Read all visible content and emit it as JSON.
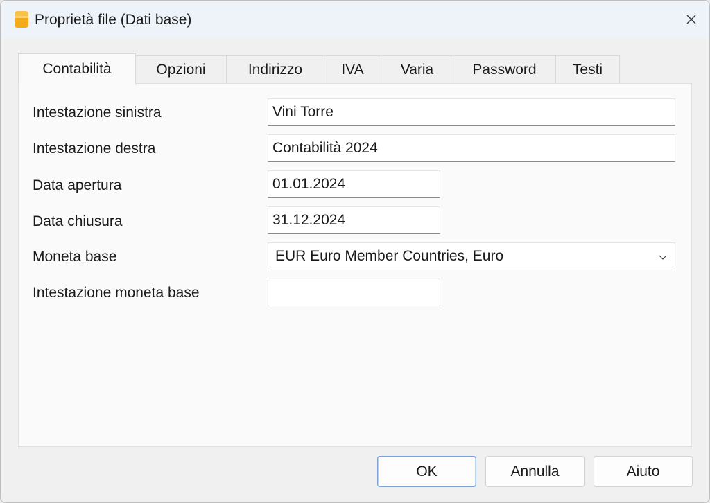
{
  "window": {
    "title": "Proprietà file (Dati base)"
  },
  "tabs": [
    {
      "label": "Contabilità",
      "active": true
    },
    {
      "label": "Opzioni"
    },
    {
      "label": "Indirizzo"
    },
    {
      "label": "IVA"
    },
    {
      "label": "Varia"
    },
    {
      "label": "Password"
    },
    {
      "label": "Testi"
    }
  ],
  "form": {
    "left_header": {
      "label": "Intestazione sinistra",
      "value": "Vini Torre"
    },
    "right_header": {
      "label": "Intestazione destra",
      "value": "Contabilità 2024"
    },
    "open_date": {
      "label": "Data apertura",
      "value": "01.01.2024"
    },
    "close_date": {
      "label": "Data chiusura",
      "value": "31.12.2024"
    },
    "base_currency": {
      "label": "Moneta base",
      "value": "EUR Euro Member Countries, Euro"
    },
    "base_currency_header": {
      "label": "Intestazione moneta base",
      "value": ""
    }
  },
  "buttons": {
    "ok": "OK",
    "cancel": "Annulla",
    "help": "Aiuto"
  },
  "icons": {
    "app": "folder-stack-icon",
    "close": "close-icon",
    "dropdown": "chevron-down-icon"
  },
  "colors": {
    "app_icon": "#f5b323",
    "titlebar": "#eef3fa",
    "primary_border": "#7aa3d3"
  }
}
